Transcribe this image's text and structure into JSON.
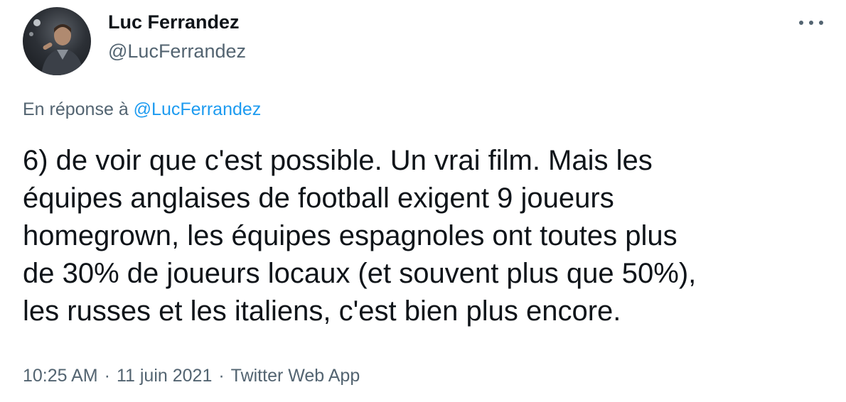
{
  "author": {
    "display_name": "Luc Ferrandez",
    "handle": "@LucFerrandez",
    "avatar_icon": "profile-photo"
  },
  "more_icon": "more-horizontal-icon",
  "reply": {
    "prefix": "En réponse à",
    "handle": "@LucFerrandez"
  },
  "tweet": {
    "lines": [
      "6) de voir que c'est possible. Un vrai film. Mais les",
      "équipes anglaises de football exigent 9 joueurs",
      "homegrown, les équipes espagnoles ont toutes plus",
      "de 30% de joueurs locaux (et souvent plus que 50%),",
      "les russes et les italiens, c'est bien plus encore."
    ]
  },
  "meta": {
    "time": "10:25 AM",
    "date": "11 juin 2021",
    "source": "Twitter Web App",
    "separator": "·"
  },
  "colors": {
    "text_primary": "#0f1419",
    "text_secondary": "#536471",
    "link": "#1d9bf0",
    "background": "#ffffff"
  }
}
